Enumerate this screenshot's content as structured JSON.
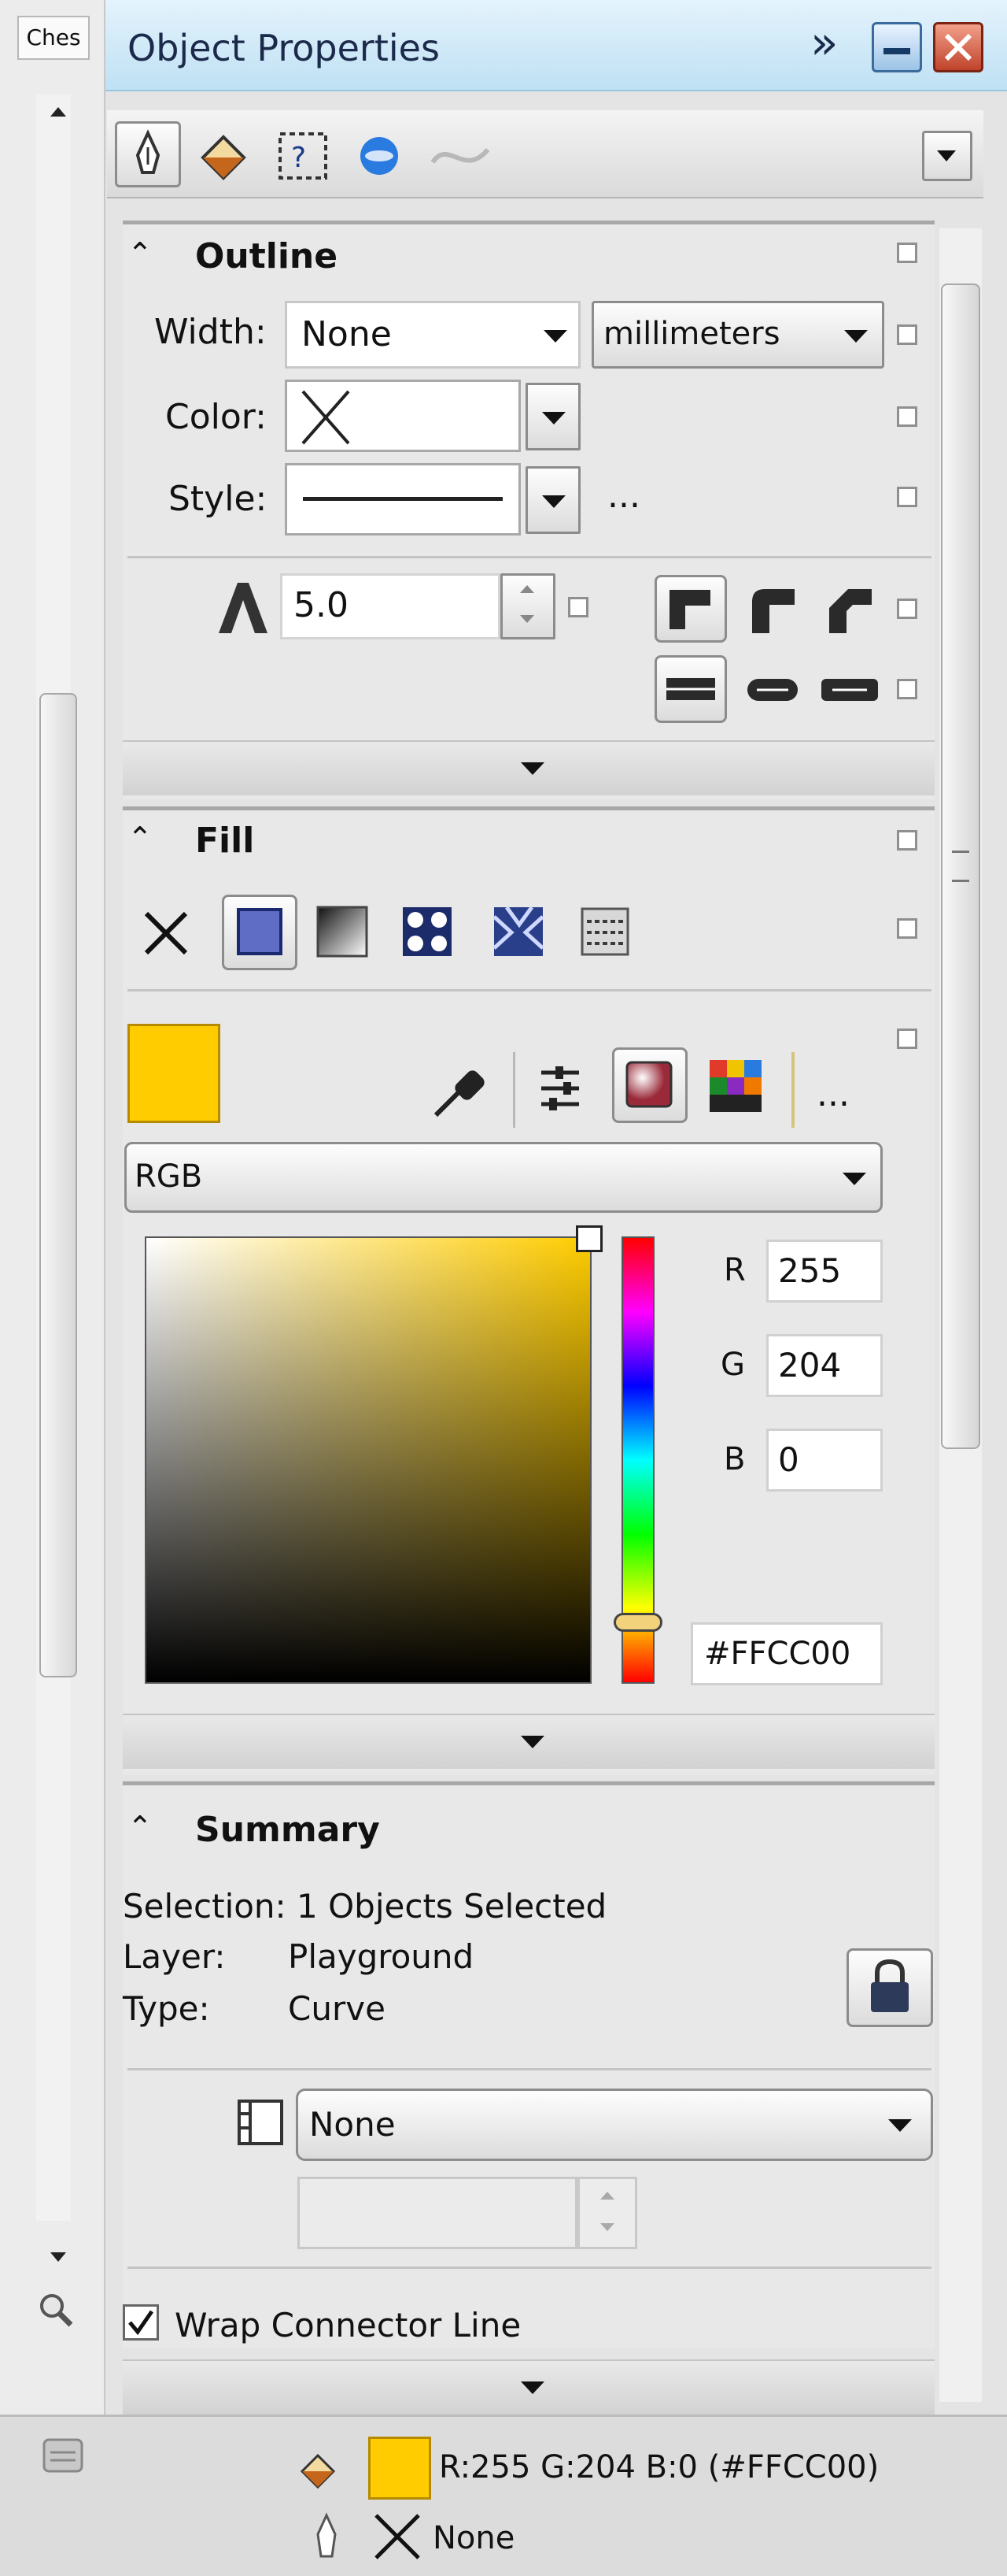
{
  "window": {
    "title": "Object Properties",
    "tab_stub": "Ches",
    "expand_symbol": "»"
  },
  "outline": {
    "header": "Outline",
    "width_label": "Width:",
    "width_value": "None",
    "unit_value": "millimeters",
    "color_label": "Color:",
    "style_label": "Style:",
    "more": "...",
    "miter_value": "5.0"
  },
  "fill": {
    "header": "Fill",
    "swatch_color": "#FFCC00",
    "more": "...",
    "model": "RGB",
    "r_label": "R",
    "r_value": "255",
    "g_label": "G",
    "g_value": "204",
    "b_label": "B",
    "b_value": "0",
    "hex_value": "#FFCC00"
  },
  "summary": {
    "header": "Summary",
    "selection": "Selection: 1 Objects Selected",
    "layer_label": "Layer:",
    "layer_value": "Playground",
    "type_label": "Type:",
    "type_value": "Curve",
    "style_value": "None"
  },
  "wrap": {
    "label": "Wrap Connector Line",
    "checked": true
  },
  "status": {
    "fill_text": "R:255 G:204 B:0 (#FFCC00)",
    "fill_color": "#FFCC00",
    "outline_text": "None"
  },
  "colors": {
    "title_bar": "#c9e6f6",
    "accent": "#FFCC00"
  }
}
